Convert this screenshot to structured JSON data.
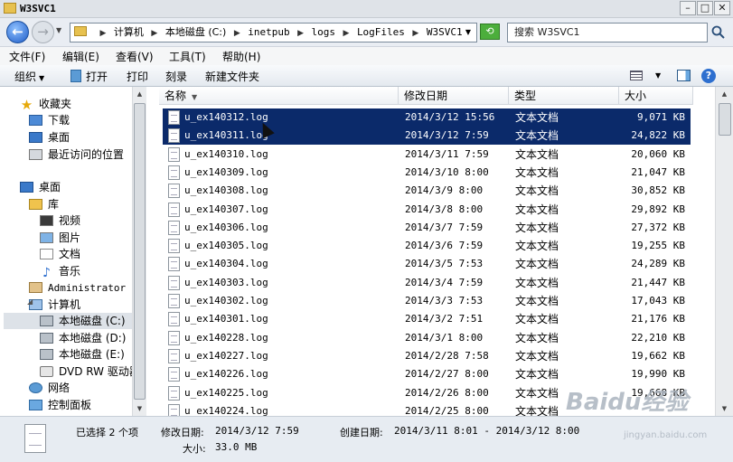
{
  "window": {
    "title": "W3SVC1"
  },
  "address": {
    "crumbs": [
      "计算机",
      "本地磁盘 (C:)",
      "inetpub",
      "logs",
      "LogFiles",
      "W3SVC1"
    ]
  },
  "search": {
    "placeholder": "搜索 W3SVC1"
  },
  "menu": [
    "文件(F)",
    "编辑(E)",
    "查看(V)",
    "工具(T)",
    "帮助(H)"
  ],
  "toolbar": {
    "organize": "组织",
    "open": "打开",
    "print": "打印",
    "burn": "刻录",
    "new_folder": "新建文件夹"
  },
  "nav": {
    "favorites": "收藏夹",
    "downloads": "下载",
    "desktop_fav": "桌面",
    "recent": "最近访问的位置",
    "desktop": "桌面",
    "library": "库",
    "videos": "视频",
    "pictures": "图片",
    "documents": "文档",
    "music": "音乐",
    "admin": "Administrator",
    "computer": "计算机",
    "drive_c": "本地磁盘 (C:)",
    "drive_d": "本地磁盘 (D:)",
    "drive_e": "本地磁盘 (E:)",
    "dvd": "DVD RW 驱动器",
    "network": "网络",
    "control_panel": "控制面板"
  },
  "columns": {
    "name": "名称",
    "modified": "修改日期",
    "type": "类型",
    "size": "大小"
  },
  "files": [
    {
      "name": "u_ex140312.log",
      "date": "2014/3/12 15:56",
      "type": "文本文档",
      "size": "9,071 KB"
    },
    {
      "name": "u_ex140311.log",
      "date": "2014/3/12 7:59",
      "type": "文本文档",
      "size": "24,822 KB"
    },
    {
      "name": "u_ex140310.log",
      "date": "2014/3/11 7:59",
      "type": "文本文档",
      "size": "20,060 KB"
    },
    {
      "name": "u_ex140309.log",
      "date": "2014/3/10 8:00",
      "type": "文本文档",
      "size": "21,047 KB"
    },
    {
      "name": "u_ex140308.log",
      "date": "2014/3/9 8:00",
      "type": "文本文档",
      "size": "30,852 KB"
    },
    {
      "name": "u_ex140307.log",
      "date": "2014/3/8 8:00",
      "type": "文本文档",
      "size": "29,892 KB"
    },
    {
      "name": "u_ex140306.log",
      "date": "2014/3/7 7:59",
      "type": "文本文档",
      "size": "27,372 KB"
    },
    {
      "name": "u_ex140305.log",
      "date": "2014/3/6 7:59",
      "type": "文本文档",
      "size": "19,255 KB"
    },
    {
      "name": "u_ex140304.log",
      "date": "2014/3/5 7:53",
      "type": "文本文档",
      "size": "24,289 KB"
    },
    {
      "name": "u_ex140303.log",
      "date": "2014/3/4 7:59",
      "type": "文本文档",
      "size": "21,447 KB"
    },
    {
      "name": "u_ex140302.log",
      "date": "2014/3/3 7:53",
      "type": "文本文档",
      "size": "17,043 KB"
    },
    {
      "name": "u_ex140301.log",
      "date": "2014/3/2 7:51",
      "type": "文本文档",
      "size": "21,176 KB"
    },
    {
      "name": "u_ex140228.log",
      "date": "2014/3/1 8:00",
      "type": "文本文档",
      "size": "22,210 KB"
    },
    {
      "name": "u_ex140227.log",
      "date": "2014/2/28 7:58",
      "type": "文本文档",
      "size": "19,662 KB"
    },
    {
      "name": "u_ex140226.log",
      "date": "2014/2/27 8:00",
      "type": "文本文档",
      "size": "19,990 KB"
    },
    {
      "name": "u_ex140225.log",
      "date": "2014/2/26 8:00",
      "type": "文本文档",
      "size": "19,668 KB"
    },
    {
      "name": "u_ex140224.log",
      "date": "2014/2/25 8:00",
      "type": "文本文档",
      "size": ""
    }
  ],
  "details": {
    "selected": "已选择 2 个项",
    "modified_label": "修改日期:",
    "modified_value": "2014/3/12 7:59",
    "created_label": "创建日期:",
    "created_value": "2014/3/11 8:01 - 2014/3/12 8:00",
    "size_label": "大小:",
    "size_value": "33.0 MB"
  },
  "watermark": {
    "logo": "Baidu经验",
    "url": "jingyan.baidu.com"
  },
  "colors": {
    "selection": "#0b2a6a",
    "chrome": "#e9edf3"
  }
}
